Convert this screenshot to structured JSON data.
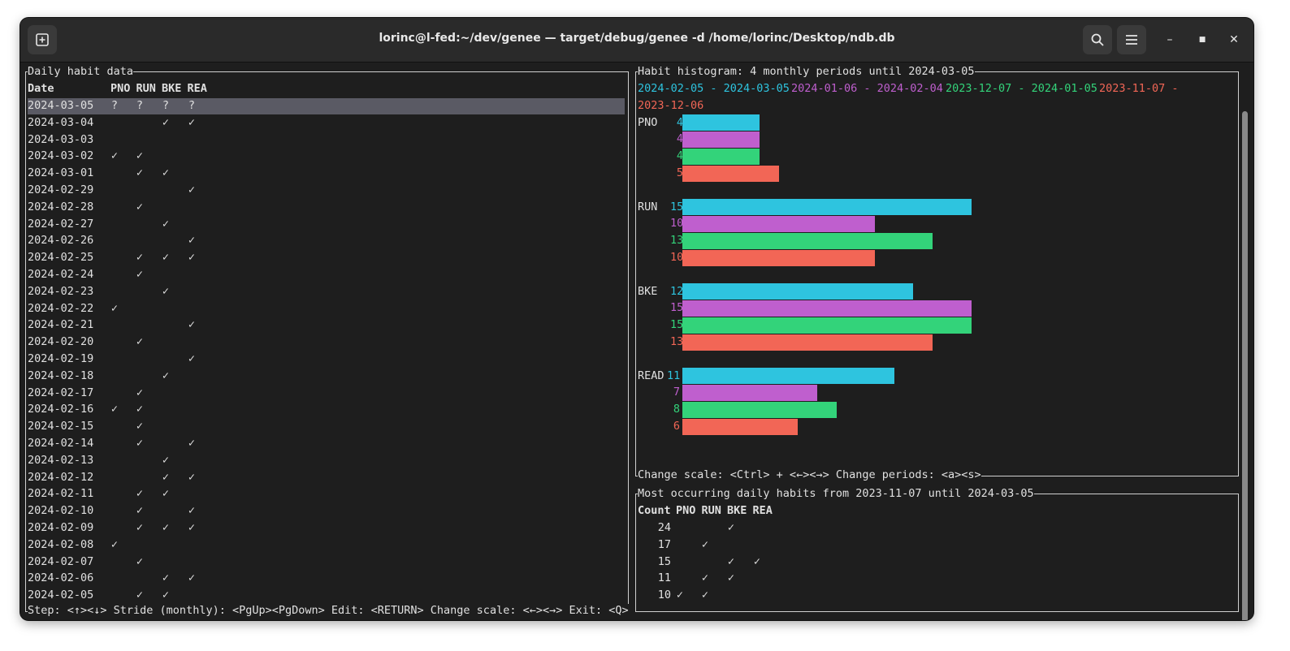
{
  "window": {
    "title": "lorinc@l-fed:~/dev/genee — target/debug/genee -d /home/lorinc/Desktop/ndb.db",
    "icons": [
      "new-tab-icon",
      "search-icon",
      "hamburger-menu-icon",
      "minimize-icon",
      "maximize-icon",
      "close-icon"
    ],
    "glyphs": {
      "minimize": "–",
      "maximize": "■",
      "close": "✕"
    }
  },
  "colors": {
    "series": [
      "#2ec4df",
      "#bf5fce",
      "#33d37a",
      "#f26656"
    ],
    "selection": "#5a5a64",
    "bg": "#1e1e1e",
    "fg": "#e0e0e0"
  },
  "daily": {
    "title": "Daily habit data",
    "columns": [
      "Date",
      "PNO",
      "RUN",
      "BKE",
      "REA"
    ],
    "rows": [
      {
        "date": "2024-03-05",
        "marks": [
          "?",
          "?",
          "?",
          "?"
        ]
      },
      {
        "date": "2024-03-04",
        "marks": [
          "",
          "",
          "✓",
          "✓"
        ]
      },
      {
        "date": "2024-03-03",
        "marks": [
          "",
          "",
          "",
          ""
        ]
      },
      {
        "date": "2024-03-02",
        "marks": [
          "✓",
          "✓",
          "",
          ""
        ]
      },
      {
        "date": "2024-03-01",
        "marks": [
          "",
          "✓",
          "✓",
          ""
        ]
      },
      {
        "date": "2024-02-29",
        "marks": [
          "",
          "",
          "",
          "✓"
        ]
      },
      {
        "date": "2024-02-28",
        "marks": [
          "",
          "✓",
          "",
          ""
        ]
      },
      {
        "date": "2024-02-27",
        "marks": [
          "",
          "",
          "✓",
          ""
        ]
      },
      {
        "date": "2024-02-26",
        "marks": [
          "",
          "",
          "",
          "✓"
        ]
      },
      {
        "date": "2024-02-25",
        "marks": [
          "",
          "✓",
          "✓",
          "✓"
        ]
      },
      {
        "date": "2024-02-24",
        "marks": [
          "",
          "✓",
          "",
          ""
        ]
      },
      {
        "date": "2024-02-23",
        "marks": [
          "",
          "",
          "✓",
          ""
        ]
      },
      {
        "date": "2024-02-22",
        "marks": [
          "✓",
          "",
          "",
          ""
        ]
      },
      {
        "date": "2024-02-21",
        "marks": [
          "",
          "",
          "",
          "✓"
        ]
      },
      {
        "date": "2024-02-20",
        "marks": [
          "",
          "✓",
          "",
          ""
        ]
      },
      {
        "date": "2024-02-19",
        "marks": [
          "",
          "",
          "",
          "✓"
        ]
      },
      {
        "date": "2024-02-18",
        "marks": [
          "",
          "",
          "✓",
          ""
        ]
      },
      {
        "date": "2024-02-17",
        "marks": [
          "",
          "✓",
          "",
          ""
        ]
      },
      {
        "date": "2024-02-16",
        "marks": [
          "✓",
          "✓",
          "",
          ""
        ]
      },
      {
        "date": "2024-02-15",
        "marks": [
          "",
          "✓",
          "",
          ""
        ]
      },
      {
        "date": "2024-02-14",
        "marks": [
          "",
          "✓",
          "",
          "✓"
        ]
      },
      {
        "date": "2024-02-13",
        "marks": [
          "",
          "",
          "✓",
          ""
        ]
      },
      {
        "date": "2024-02-12",
        "marks": [
          "",
          "",
          "✓",
          "✓"
        ]
      },
      {
        "date": "2024-02-11",
        "marks": [
          "",
          "✓",
          "✓",
          ""
        ]
      },
      {
        "date": "2024-02-10",
        "marks": [
          "",
          "✓",
          "",
          "✓"
        ]
      },
      {
        "date": "2024-02-09",
        "marks": [
          "",
          "✓",
          "✓",
          "✓"
        ]
      },
      {
        "date": "2024-02-08",
        "marks": [
          "✓",
          "",
          "",
          ""
        ]
      },
      {
        "date": "2024-02-07",
        "marks": [
          "",
          "✓",
          "",
          ""
        ]
      },
      {
        "date": "2024-02-06",
        "marks": [
          "",
          "",
          "✓",
          "✓"
        ]
      },
      {
        "date": "2024-02-05",
        "marks": [
          "",
          "✓",
          "✓",
          ""
        ]
      }
    ],
    "footer": "Step: <↑><↓> Stride (monthly): <PgUp><PgDown> Edit: <RETURN> Change scale: <←><→> Exit: <Q>"
  },
  "histogram": {
    "title": "Habit histogram: 4 monthly periods until 2024-03-05",
    "footer": "Change scale: <Ctrl> + <←><→> Change periods: <a><s>",
    "legend": [
      {
        "text": "2024-02-05 - 2024-03-05",
        "color": "#2ec4df"
      },
      {
        "text": "2024-01-06 - 2024-02-04",
        "color": "#bf5fce"
      },
      {
        "text": "2023-12-07 - 2024-01-05",
        "color": "#33d37a"
      },
      {
        "text": "2023-11-07 -",
        "color": "#f26656"
      },
      {
        "text": "2023-12-06",
        "color": "#f26656"
      }
    ]
  },
  "chart_data": {
    "type": "bar",
    "orientation": "horizontal",
    "title": "Habit histogram: 4 monthly periods until 2024-03-05",
    "categories": [
      "PNO",
      "RUN",
      "BKE",
      "READ"
    ],
    "series": [
      {
        "name": "2024-02-05 - 2024-03-05",
        "color": "#2ec4df",
        "values": [
          4,
          15,
          12,
          11
        ]
      },
      {
        "name": "2024-01-06 - 2024-02-04",
        "color": "#bf5fce",
        "values": [
          4,
          10,
          15,
          7
        ]
      },
      {
        "name": "2023-12-07 - 2024-01-05",
        "color": "#33d37a",
        "values": [
          4,
          13,
          15,
          8
        ]
      },
      {
        "name": "2023-11-07 - 2023-12-06",
        "color": "#f26656",
        "values": [
          5,
          10,
          13,
          6
        ]
      }
    ],
    "legend": "top"
  },
  "most": {
    "title": "Most occurring daily habits from 2023-11-07 until 2024-03-05",
    "columns": [
      "Count",
      "PNO",
      "RUN",
      "BKE",
      "REA"
    ],
    "rows": [
      {
        "count": "24",
        "marks": [
          "",
          "",
          "✓",
          ""
        ]
      },
      {
        "count": "17",
        "marks": [
          "",
          "✓",
          "",
          ""
        ]
      },
      {
        "count": "15",
        "marks": [
          "",
          "",
          "✓",
          "✓"
        ]
      },
      {
        "count": "11",
        "marks": [
          "",
          "✓",
          "✓",
          ""
        ]
      },
      {
        "count": "10",
        "marks": [
          "✓",
          "✓",
          "",
          ""
        ]
      }
    ]
  }
}
